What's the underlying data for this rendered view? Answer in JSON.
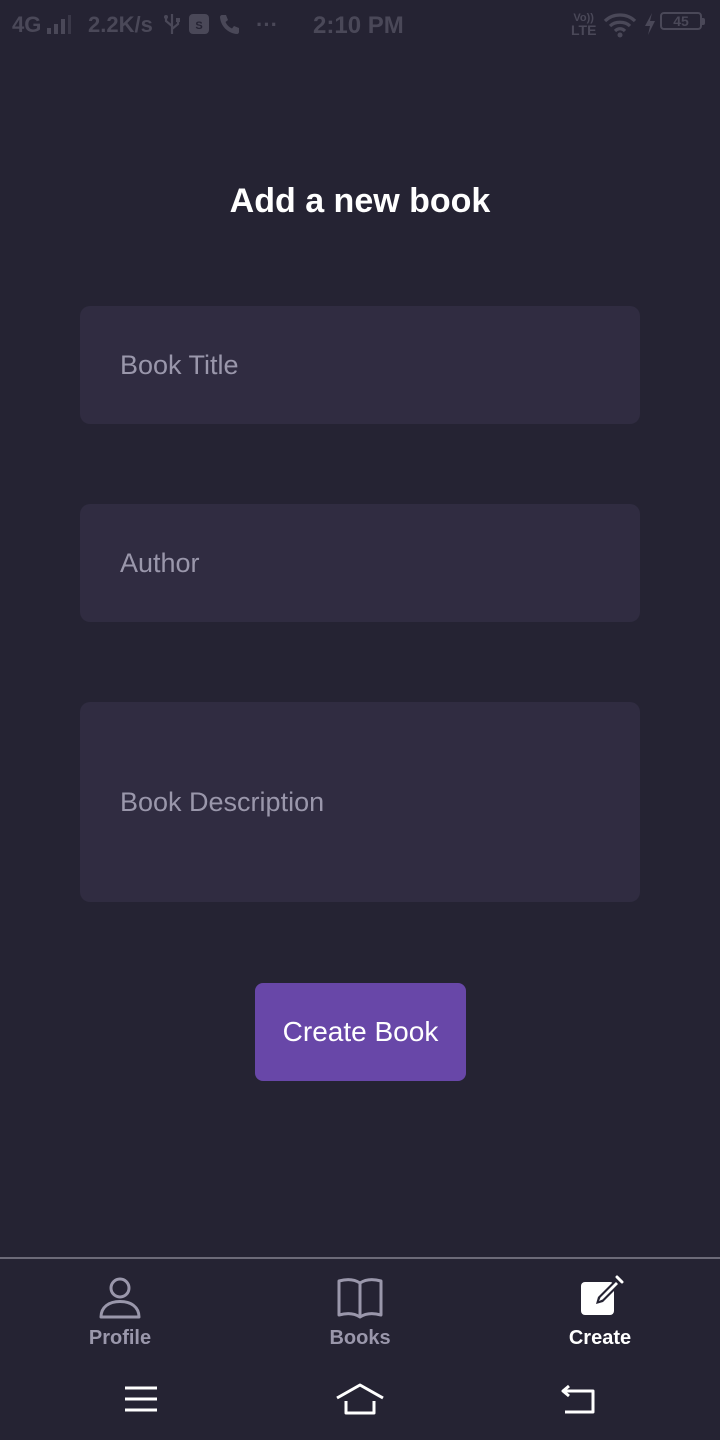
{
  "status_bar": {
    "network": "4G",
    "speed": "2.2K/s",
    "more": "···",
    "time": "2:10 PM",
    "volte_top": "Vo))",
    "volte_bottom": "LTE",
    "battery": "45"
  },
  "form": {
    "title": "Add a new book",
    "book_title_placeholder": "Book Title",
    "author_placeholder": "Author",
    "description_placeholder": "Book Description",
    "submit_label": "Create Book"
  },
  "tabs": [
    {
      "label": "Profile",
      "icon": "person-icon",
      "active": false
    },
    {
      "label": "Books",
      "icon": "book-open-icon",
      "active": false
    },
    {
      "label": "Create",
      "icon": "edit-icon",
      "active": true
    }
  ],
  "system_nav": {
    "icons": [
      "menu-icon",
      "home-icon",
      "back-icon"
    ]
  },
  "colors": {
    "background": "#252333",
    "field_background": "#302c41",
    "button": "#6847a8",
    "placeholder": "#9a97ab",
    "status_bar_text": "#4a4858"
  }
}
